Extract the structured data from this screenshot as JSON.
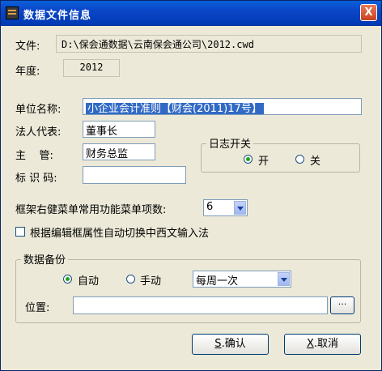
{
  "window": {
    "title": "数据文件信息",
    "close_glyph": "X"
  },
  "file": {
    "label": "文件:",
    "value": "D:\\保会通数据\\云南保会通公司\\2012.cwd"
  },
  "year": {
    "label": "年度:",
    "value": "2012"
  },
  "unit_name": {
    "label": "单位名称:",
    "value": "小企业会计准则【财会(2011)17号】"
  },
  "legal_rep": {
    "label": "法人代表:",
    "value": "董事长"
  },
  "supervisor": {
    "label": "主    管:",
    "value": "财务总监"
  },
  "id_code": {
    "label": "标 识 码:",
    "value": ""
  },
  "log_switch": {
    "title": "日志开关",
    "on_label": "开",
    "off_label": "关",
    "selected": "on"
  },
  "menu_items": {
    "label": "框架右健菜单常用功能菜单项数:",
    "value": "6"
  },
  "auto_ime": {
    "label": "根据编辑框属性自动切换中西文输入法",
    "checked": false
  },
  "backup": {
    "title": "数据备份",
    "auto_label": "自动",
    "manual_label": "手动",
    "selected": "auto",
    "frequency": "每周一次",
    "location_label": "位置:",
    "location_value": "",
    "browse_label": "···"
  },
  "buttons": {
    "ok_key": "S",
    "ok_label": ".确认",
    "cancel_key": "X",
    "cancel_label": ".取消"
  }
}
